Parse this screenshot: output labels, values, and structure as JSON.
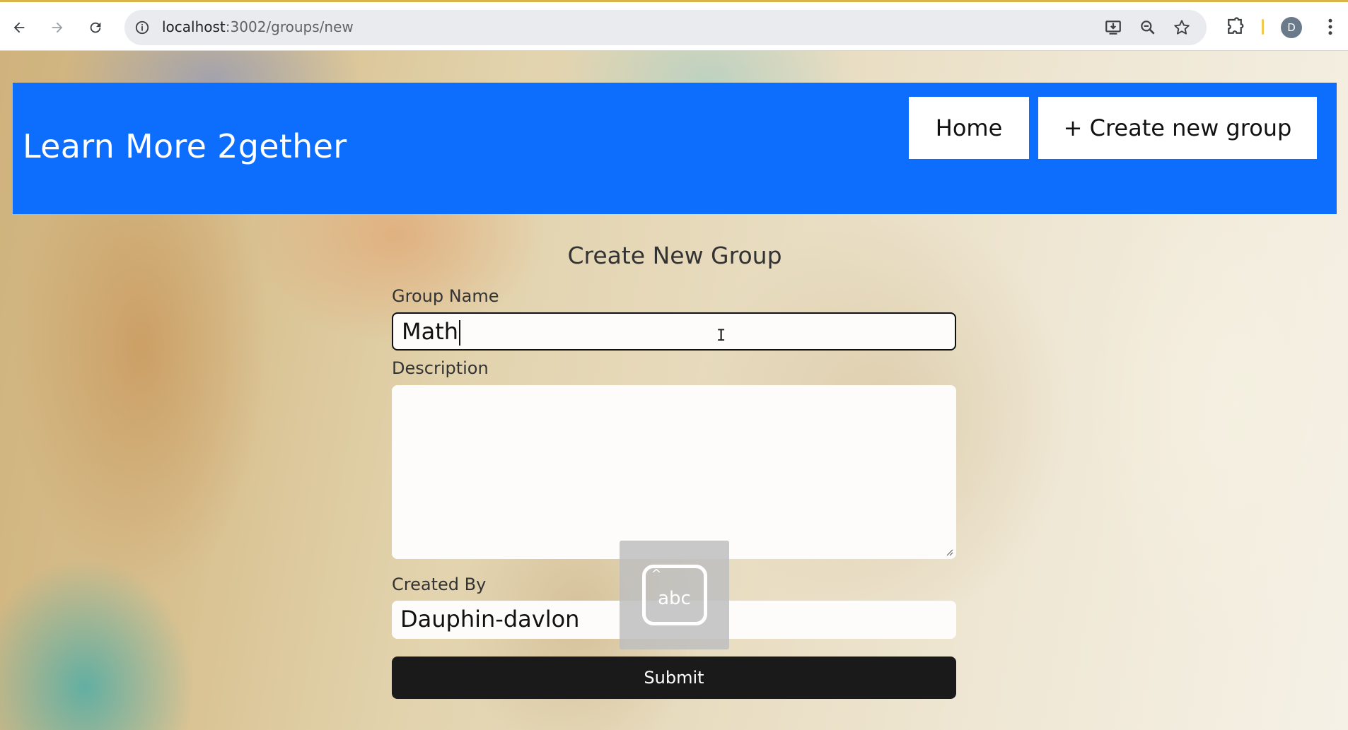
{
  "browser": {
    "url_host": "localhost",
    "url_path": ":3002/groups/new",
    "profile_initial": "D",
    "icons": [
      "back-arrow-icon",
      "forward-arrow-icon",
      "reload-icon",
      "site-info-icon",
      "install-app-icon",
      "zoom-icon",
      "bookmark-star-icon",
      "extensions-puzzle-icon",
      "more-vert-icon"
    ]
  },
  "header": {
    "brand": "Learn More 2gether",
    "nav": {
      "home_label": "Home",
      "create_label": "+ Create new group"
    },
    "color": "#0d6efd"
  },
  "form": {
    "title": "Create New Group",
    "group_name": {
      "label": "Group Name",
      "value": "Math"
    },
    "description": {
      "label": "Description",
      "value": ""
    },
    "created_by": {
      "label": "Created By",
      "value": "Dauphin-davlon"
    },
    "submit_label": "Submit"
  },
  "ime_indicator": {
    "text": "abc",
    "icon": "keyboard-case-icon"
  }
}
